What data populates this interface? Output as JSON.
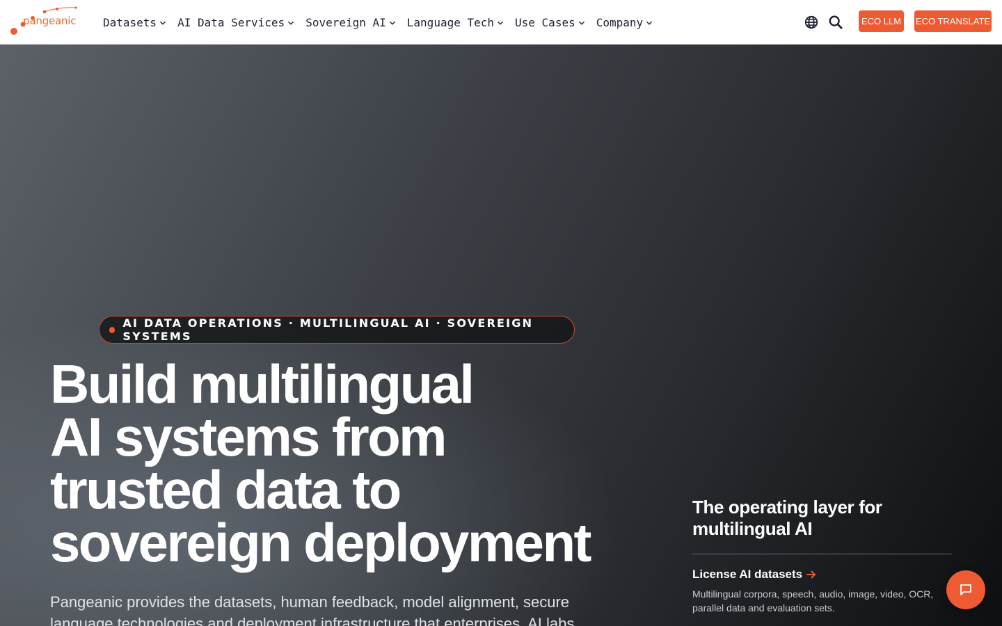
{
  "brand": {
    "name": "pangeanic",
    "accent_color": "#ee5a31"
  },
  "nav": {
    "items": [
      {
        "label": "Datasets",
        "icon": "chevron-down-icon"
      },
      {
        "label": "AI Data Services",
        "icon": "chevron-down-icon"
      },
      {
        "label": "Sovereign AI",
        "icon": "chevron-down-icon"
      },
      {
        "label": "Language Tech",
        "icon": "chevron-down-icon"
      },
      {
        "label": "Use Cases",
        "icon": "chevron-down-icon"
      },
      {
        "label": "Company",
        "icon": "chevron-down-icon"
      }
    ]
  },
  "header_tools": {
    "globe_icon": "globe-icon",
    "search_icon": "search-icon",
    "eco_llm_label": "ECO LLM",
    "eco_translate_label": "ECO TRANSLATE"
  },
  "hero": {
    "eyebrow": "AI DATA OPERATIONS · MULTILINGUAL AI · SOVEREIGN SYSTEMS",
    "headline_lines": [
      "Build multilingual",
      "AI systems from",
      "trusted data to",
      "sovereign deployment"
    ],
    "subcopy": "Pangeanic provides the datasets, human feedback, model alignment, secure language technologies and deployment infrastructure that enterprises, AI labs"
  },
  "side_panel": {
    "title": "The operating layer for multilingual AI",
    "links": [
      {
        "label": "License AI datasets",
        "description": "Multilingual corpora, speech, audio, image, video, OCR, parallel data and evaluation sets."
      }
    ]
  },
  "chat": {
    "icon": "chat-icon"
  }
}
